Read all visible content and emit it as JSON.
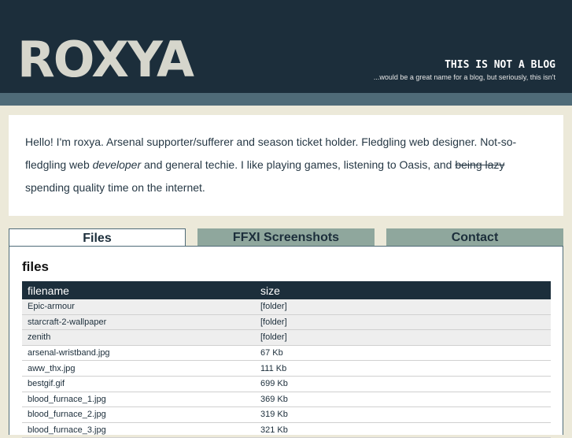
{
  "header": {
    "logo": "ROXYA",
    "tagline": "THIS IS NOT A BLOG",
    "subtagline": "...would be a great name for a blog, but seriously, this isn't"
  },
  "intro": {
    "part1": "Hello! I'm roxya. Arsenal supporter/sufferer and season ticket holder. Fledgling web designer. Not-so-fledgling web ",
    "emph": "developer",
    "part2": " and general techie. I like playing games, listening to Oasis, and ",
    "struck": "being lazy",
    "part3": " spending quality time on the internet."
  },
  "tabs": [
    {
      "label": "Files"
    },
    {
      "label": "FFXI Screenshots"
    },
    {
      "label": "Contact"
    }
  ],
  "panel": {
    "title": "files",
    "columns": [
      "filename",
      "size"
    ],
    "rows": [
      {
        "name": "Epic-armour",
        "size": "[folder]"
      },
      {
        "name": "starcraft-2-wallpaper",
        "size": "[folder]"
      },
      {
        "name": "zenith",
        "size": "[folder]"
      },
      {
        "name": "arsenal-wristband.jpg",
        "size": "67 Kb"
      },
      {
        "name": "aww_thx.jpg",
        "size": "111 Kb"
      },
      {
        "name": "bestgif.gif",
        "size": "699 Kb"
      },
      {
        "name": "blood_furnace_1.jpg",
        "size": "369 Kb"
      },
      {
        "name": "blood_furnace_2.jpg",
        "size": "319 Kb"
      },
      {
        "name": "blood_furnace_3.jpg",
        "size": "321 Kb"
      }
    ]
  }
}
